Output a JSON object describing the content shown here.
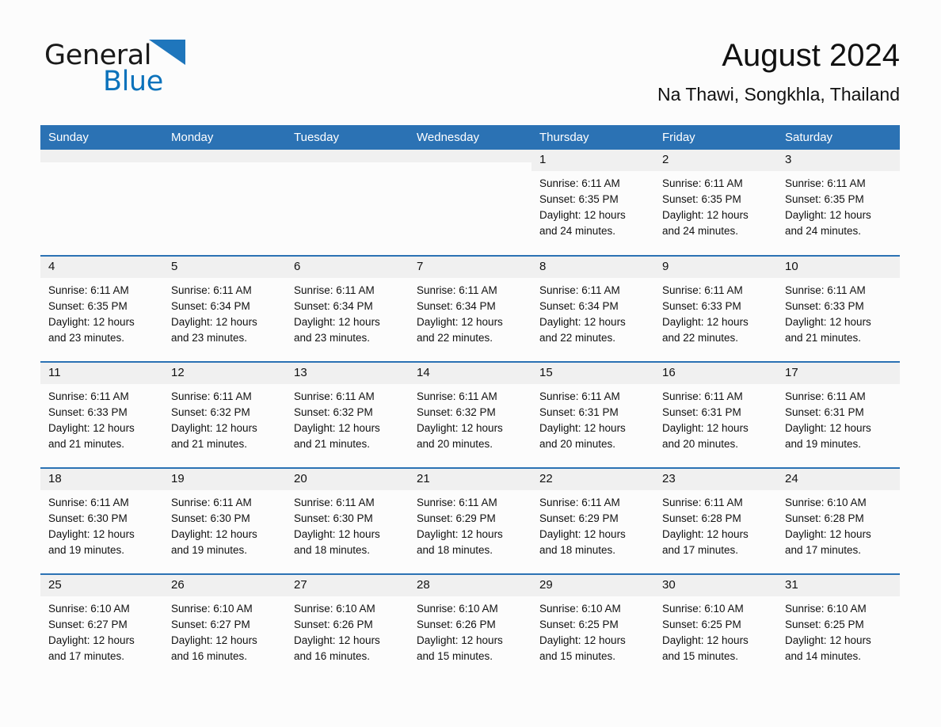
{
  "brand": {
    "name_dark": "General",
    "name_blue": "Blue",
    "triangle_color": "#1f76bc",
    "blue_color": "#0b72bb"
  },
  "header": {
    "title": "August 2024",
    "subtitle": "Na Thawi, Songkhla, Thailand"
  },
  "colors": {
    "header_blue": "#2b72b4",
    "daynum_gray": "#f0f0f0",
    "page_background": "#fcfcfc"
  },
  "weekday_headers": [
    "Sunday",
    "Monday",
    "Tuesday",
    "Wednesday",
    "Thursday",
    "Friday",
    "Saturday"
  ],
  "weeks": [
    [
      {
        "day": "",
        "sunrise": "",
        "sunset": "",
        "daylight_line1": "",
        "daylight_line2": ""
      },
      {
        "day": "",
        "sunrise": "",
        "sunset": "",
        "daylight_line1": "",
        "daylight_line2": ""
      },
      {
        "day": "",
        "sunrise": "",
        "sunset": "",
        "daylight_line1": "",
        "daylight_line2": ""
      },
      {
        "day": "",
        "sunrise": "",
        "sunset": "",
        "daylight_line1": "",
        "daylight_line2": ""
      },
      {
        "day": "1",
        "sunrise": "Sunrise: 6:11 AM",
        "sunset": "Sunset: 6:35 PM",
        "daylight_line1": "Daylight: 12 hours",
        "daylight_line2": "and 24 minutes."
      },
      {
        "day": "2",
        "sunrise": "Sunrise: 6:11 AM",
        "sunset": "Sunset: 6:35 PM",
        "daylight_line1": "Daylight: 12 hours",
        "daylight_line2": "and 24 minutes."
      },
      {
        "day": "3",
        "sunrise": "Sunrise: 6:11 AM",
        "sunset": "Sunset: 6:35 PM",
        "daylight_line1": "Daylight: 12 hours",
        "daylight_line2": "and 24 minutes."
      }
    ],
    [
      {
        "day": "4",
        "sunrise": "Sunrise: 6:11 AM",
        "sunset": "Sunset: 6:35 PM",
        "daylight_line1": "Daylight: 12 hours",
        "daylight_line2": "and 23 minutes."
      },
      {
        "day": "5",
        "sunrise": "Sunrise: 6:11 AM",
        "sunset": "Sunset: 6:34 PM",
        "daylight_line1": "Daylight: 12 hours",
        "daylight_line2": "and 23 minutes."
      },
      {
        "day": "6",
        "sunrise": "Sunrise: 6:11 AM",
        "sunset": "Sunset: 6:34 PM",
        "daylight_line1": "Daylight: 12 hours",
        "daylight_line2": "and 23 minutes."
      },
      {
        "day": "7",
        "sunrise": "Sunrise: 6:11 AM",
        "sunset": "Sunset: 6:34 PM",
        "daylight_line1": "Daylight: 12 hours",
        "daylight_line2": "and 22 minutes."
      },
      {
        "day": "8",
        "sunrise": "Sunrise: 6:11 AM",
        "sunset": "Sunset: 6:34 PM",
        "daylight_line1": "Daylight: 12 hours",
        "daylight_line2": "and 22 minutes."
      },
      {
        "day": "9",
        "sunrise": "Sunrise: 6:11 AM",
        "sunset": "Sunset: 6:33 PM",
        "daylight_line1": "Daylight: 12 hours",
        "daylight_line2": "and 22 minutes."
      },
      {
        "day": "10",
        "sunrise": "Sunrise: 6:11 AM",
        "sunset": "Sunset: 6:33 PM",
        "daylight_line1": "Daylight: 12 hours",
        "daylight_line2": "and 21 minutes."
      }
    ],
    [
      {
        "day": "11",
        "sunrise": "Sunrise: 6:11 AM",
        "sunset": "Sunset: 6:33 PM",
        "daylight_line1": "Daylight: 12 hours",
        "daylight_line2": "and 21 minutes."
      },
      {
        "day": "12",
        "sunrise": "Sunrise: 6:11 AM",
        "sunset": "Sunset: 6:32 PM",
        "daylight_line1": "Daylight: 12 hours",
        "daylight_line2": "and 21 minutes."
      },
      {
        "day": "13",
        "sunrise": "Sunrise: 6:11 AM",
        "sunset": "Sunset: 6:32 PM",
        "daylight_line1": "Daylight: 12 hours",
        "daylight_line2": "and 21 minutes."
      },
      {
        "day": "14",
        "sunrise": "Sunrise: 6:11 AM",
        "sunset": "Sunset: 6:32 PM",
        "daylight_line1": "Daylight: 12 hours",
        "daylight_line2": "and 20 minutes."
      },
      {
        "day": "15",
        "sunrise": "Sunrise: 6:11 AM",
        "sunset": "Sunset: 6:31 PM",
        "daylight_line1": "Daylight: 12 hours",
        "daylight_line2": "and 20 minutes."
      },
      {
        "day": "16",
        "sunrise": "Sunrise: 6:11 AM",
        "sunset": "Sunset: 6:31 PM",
        "daylight_line1": "Daylight: 12 hours",
        "daylight_line2": "and 20 minutes."
      },
      {
        "day": "17",
        "sunrise": "Sunrise: 6:11 AM",
        "sunset": "Sunset: 6:31 PM",
        "daylight_line1": "Daylight: 12 hours",
        "daylight_line2": "and 19 minutes."
      }
    ],
    [
      {
        "day": "18",
        "sunrise": "Sunrise: 6:11 AM",
        "sunset": "Sunset: 6:30 PM",
        "daylight_line1": "Daylight: 12 hours",
        "daylight_line2": "and 19 minutes."
      },
      {
        "day": "19",
        "sunrise": "Sunrise: 6:11 AM",
        "sunset": "Sunset: 6:30 PM",
        "daylight_line1": "Daylight: 12 hours",
        "daylight_line2": "and 19 minutes."
      },
      {
        "day": "20",
        "sunrise": "Sunrise: 6:11 AM",
        "sunset": "Sunset: 6:30 PM",
        "daylight_line1": "Daylight: 12 hours",
        "daylight_line2": "and 18 minutes."
      },
      {
        "day": "21",
        "sunrise": "Sunrise: 6:11 AM",
        "sunset": "Sunset: 6:29 PM",
        "daylight_line1": "Daylight: 12 hours",
        "daylight_line2": "and 18 minutes."
      },
      {
        "day": "22",
        "sunrise": "Sunrise: 6:11 AM",
        "sunset": "Sunset: 6:29 PM",
        "daylight_line1": "Daylight: 12 hours",
        "daylight_line2": "and 18 minutes."
      },
      {
        "day": "23",
        "sunrise": "Sunrise: 6:11 AM",
        "sunset": "Sunset: 6:28 PM",
        "daylight_line1": "Daylight: 12 hours",
        "daylight_line2": "and 17 minutes."
      },
      {
        "day": "24",
        "sunrise": "Sunrise: 6:10 AM",
        "sunset": "Sunset: 6:28 PM",
        "daylight_line1": "Daylight: 12 hours",
        "daylight_line2": "and 17 minutes."
      }
    ],
    [
      {
        "day": "25",
        "sunrise": "Sunrise: 6:10 AM",
        "sunset": "Sunset: 6:27 PM",
        "daylight_line1": "Daylight: 12 hours",
        "daylight_line2": "and 17 minutes."
      },
      {
        "day": "26",
        "sunrise": "Sunrise: 6:10 AM",
        "sunset": "Sunset: 6:27 PM",
        "daylight_line1": "Daylight: 12 hours",
        "daylight_line2": "and 16 minutes."
      },
      {
        "day": "27",
        "sunrise": "Sunrise: 6:10 AM",
        "sunset": "Sunset: 6:26 PM",
        "daylight_line1": "Daylight: 12 hours",
        "daylight_line2": "and 16 minutes."
      },
      {
        "day": "28",
        "sunrise": "Sunrise: 6:10 AM",
        "sunset": "Sunset: 6:26 PM",
        "daylight_line1": "Daylight: 12 hours",
        "daylight_line2": "and 15 minutes."
      },
      {
        "day": "29",
        "sunrise": "Sunrise: 6:10 AM",
        "sunset": "Sunset: 6:25 PM",
        "daylight_line1": "Daylight: 12 hours",
        "daylight_line2": "and 15 minutes."
      },
      {
        "day": "30",
        "sunrise": "Sunrise: 6:10 AM",
        "sunset": "Sunset: 6:25 PM",
        "daylight_line1": "Daylight: 12 hours",
        "daylight_line2": "and 15 minutes."
      },
      {
        "day": "31",
        "sunrise": "Sunrise: 6:10 AM",
        "sunset": "Sunset: 6:25 PM",
        "daylight_line1": "Daylight: 12 hours",
        "daylight_line2": "and 14 minutes."
      }
    ]
  ]
}
